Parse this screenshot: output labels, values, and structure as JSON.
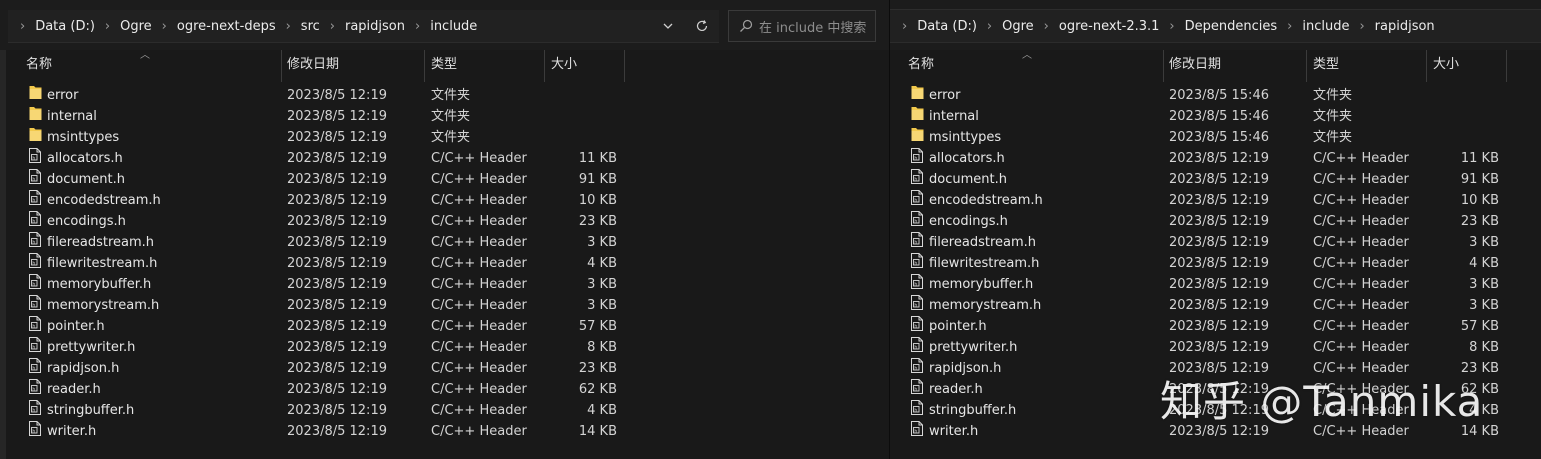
{
  "left": {
    "breadcrumb": [
      "Data (D:)",
      "Ogre",
      "ogre-next-deps",
      "src",
      "rapidjson",
      "include"
    ],
    "search_placeholder": "在 include 中搜索",
    "columns": [
      "名称",
      "修改日期",
      "类型",
      "大小"
    ],
    "files": [
      {
        "name": "error",
        "date": "2023/8/5 12:19",
        "type": "文件夹",
        "size": "",
        "kind": "folder"
      },
      {
        "name": "internal",
        "date": "2023/8/5 12:19",
        "type": "文件夹",
        "size": "",
        "kind": "folder"
      },
      {
        "name": "msinttypes",
        "date": "2023/8/5 12:19",
        "type": "文件夹",
        "size": "",
        "kind": "folder"
      },
      {
        "name": "allocators.h",
        "date": "2023/8/5 12:19",
        "type": "C/C++ Header",
        "size": "11 KB",
        "kind": "file"
      },
      {
        "name": "document.h",
        "date": "2023/8/5 12:19",
        "type": "C/C++ Header",
        "size": "91 KB",
        "kind": "file"
      },
      {
        "name": "encodedstream.h",
        "date": "2023/8/5 12:19",
        "type": "C/C++ Header",
        "size": "10 KB",
        "kind": "file"
      },
      {
        "name": "encodings.h",
        "date": "2023/8/5 12:19",
        "type": "C/C++ Header",
        "size": "23 KB",
        "kind": "file"
      },
      {
        "name": "filereadstream.h",
        "date": "2023/8/5 12:19",
        "type": "C/C++ Header",
        "size": "3 KB",
        "kind": "file"
      },
      {
        "name": "filewritestream.h",
        "date": "2023/8/5 12:19",
        "type": "C/C++ Header",
        "size": "4 KB",
        "kind": "file"
      },
      {
        "name": "memorybuffer.h",
        "date": "2023/8/5 12:19",
        "type": "C/C++ Header",
        "size": "3 KB",
        "kind": "file"
      },
      {
        "name": "memorystream.h",
        "date": "2023/8/5 12:19",
        "type": "C/C++ Header",
        "size": "3 KB",
        "kind": "file"
      },
      {
        "name": "pointer.h",
        "date": "2023/8/5 12:19",
        "type": "C/C++ Header",
        "size": "57 KB",
        "kind": "file"
      },
      {
        "name": "prettywriter.h",
        "date": "2023/8/5 12:19",
        "type": "C/C++ Header",
        "size": "8 KB",
        "kind": "file"
      },
      {
        "name": "rapidjson.h",
        "date": "2023/8/5 12:19",
        "type": "C/C++ Header",
        "size": "23 KB",
        "kind": "file"
      },
      {
        "name": "reader.h",
        "date": "2023/8/5 12:19",
        "type": "C/C++ Header",
        "size": "62 KB",
        "kind": "file"
      },
      {
        "name": "stringbuffer.h",
        "date": "2023/8/5 12:19",
        "type": "C/C++ Header",
        "size": "4 KB",
        "kind": "file"
      },
      {
        "name": "writer.h",
        "date": "2023/8/5 12:19",
        "type": "C/C++ Header",
        "size": "14 KB",
        "kind": "file"
      }
    ]
  },
  "right": {
    "breadcrumb": [
      "Data (D:)",
      "Ogre",
      "ogre-next-2.3.1",
      "Dependencies",
      "include",
      "rapidjson"
    ],
    "columns": [
      "名称",
      "修改日期",
      "类型",
      "大小"
    ],
    "files": [
      {
        "name": "error",
        "date": "2023/8/5 15:46",
        "type": "文件夹",
        "size": "",
        "kind": "folder"
      },
      {
        "name": "internal",
        "date": "2023/8/5 15:46",
        "type": "文件夹",
        "size": "",
        "kind": "folder"
      },
      {
        "name": "msinttypes",
        "date": "2023/8/5 15:46",
        "type": "文件夹",
        "size": "",
        "kind": "folder"
      },
      {
        "name": "allocators.h",
        "date": "2023/8/5 12:19",
        "type": "C/C++ Header",
        "size": "11 KB",
        "kind": "file"
      },
      {
        "name": "document.h",
        "date": "2023/8/5 12:19",
        "type": "C/C++ Header",
        "size": "91 KB",
        "kind": "file"
      },
      {
        "name": "encodedstream.h",
        "date": "2023/8/5 12:19",
        "type": "C/C++ Header",
        "size": "10 KB",
        "kind": "file"
      },
      {
        "name": "encodings.h",
        "date": "2023/8/5 12:19",
        "type": "C/C++ Header",
        "size": "23 KB",
        "kind": "file"
      },
      {
        "name": "filereadstream.h",
        "date": "2023/8/5 12:19",
        "type": "C/C++ Header",
        "size": "3 KB",
        "kind": "file"
      },
      {
        "name": "filewritestream.h",
        "date": "2023/8/5 12:19",
        "type": "C/C++ Header",
        "size": "4 KB",
        "kind": "file"
      },
      {
        "name": "memorybuffer.h",
        "date": "2023/8/5 12:19",
        "type": "C/C++ Header",
        "size": "3 KB",
        "kind": "file"
      },
      {
        "name": "memorystream.h",
        "date": "2023/8/5 12:19",
        "type": "C/C++ Header",
        "size": "3 KB",
        "kind": "file"
      },
      {
        "name": "pointer.h",
        "date": "2023/8/5 12:19",
        "type": "C/C++ Header",
        "size": "57 KB",
        "kind": "file"
      },
      {
        "name": "prettywriter.h",
        "date": "2023/8/5 12:19",
        "type": "C/C++ Header",
        "size": "8 KB",
        "kind": "file"
      },
      {
        "name": "rapidjson.h",
        "date": "2023/8/5 12:19",
        "type": "C/C++ Header",
        "size": "23 KB",
        "kind": "file"
      },
      {
        "name": "reader.h",
        "date": "2023/8/5 12:19",
        "type": "C/C++ Header",
        "size": "62 KB",
        "kind": "file"
      },
      {
        "name": "stringbuffer.h",
        "date": "2023/8/5 12:19",
        "type": "C/C++ Header",
        "size": "4 KB",
        "kind": "file"
      },
      {
        "name": "writer.h",
        "date": "2023/8/5 12:19",
        "type": "C/C++ Header",
        "size": "14 KB",
        "kind": "file"
      }
    ]
  },
  "watermark": "知乎 @Tanmika",
  "colors": {
    "background": "#191919",
    "folder": "#f2c94c",
    "text": "#e6e6e6"
  },
  "icons": {
    "folder": "folder-icon",
    "file": "header-file-icon",
    "search": "search-icon",
    "dropdown": "chevron-down-icon",
    "refresh": "refresh-icon",
    "separator": "chevron-right-icon"
  }
}
